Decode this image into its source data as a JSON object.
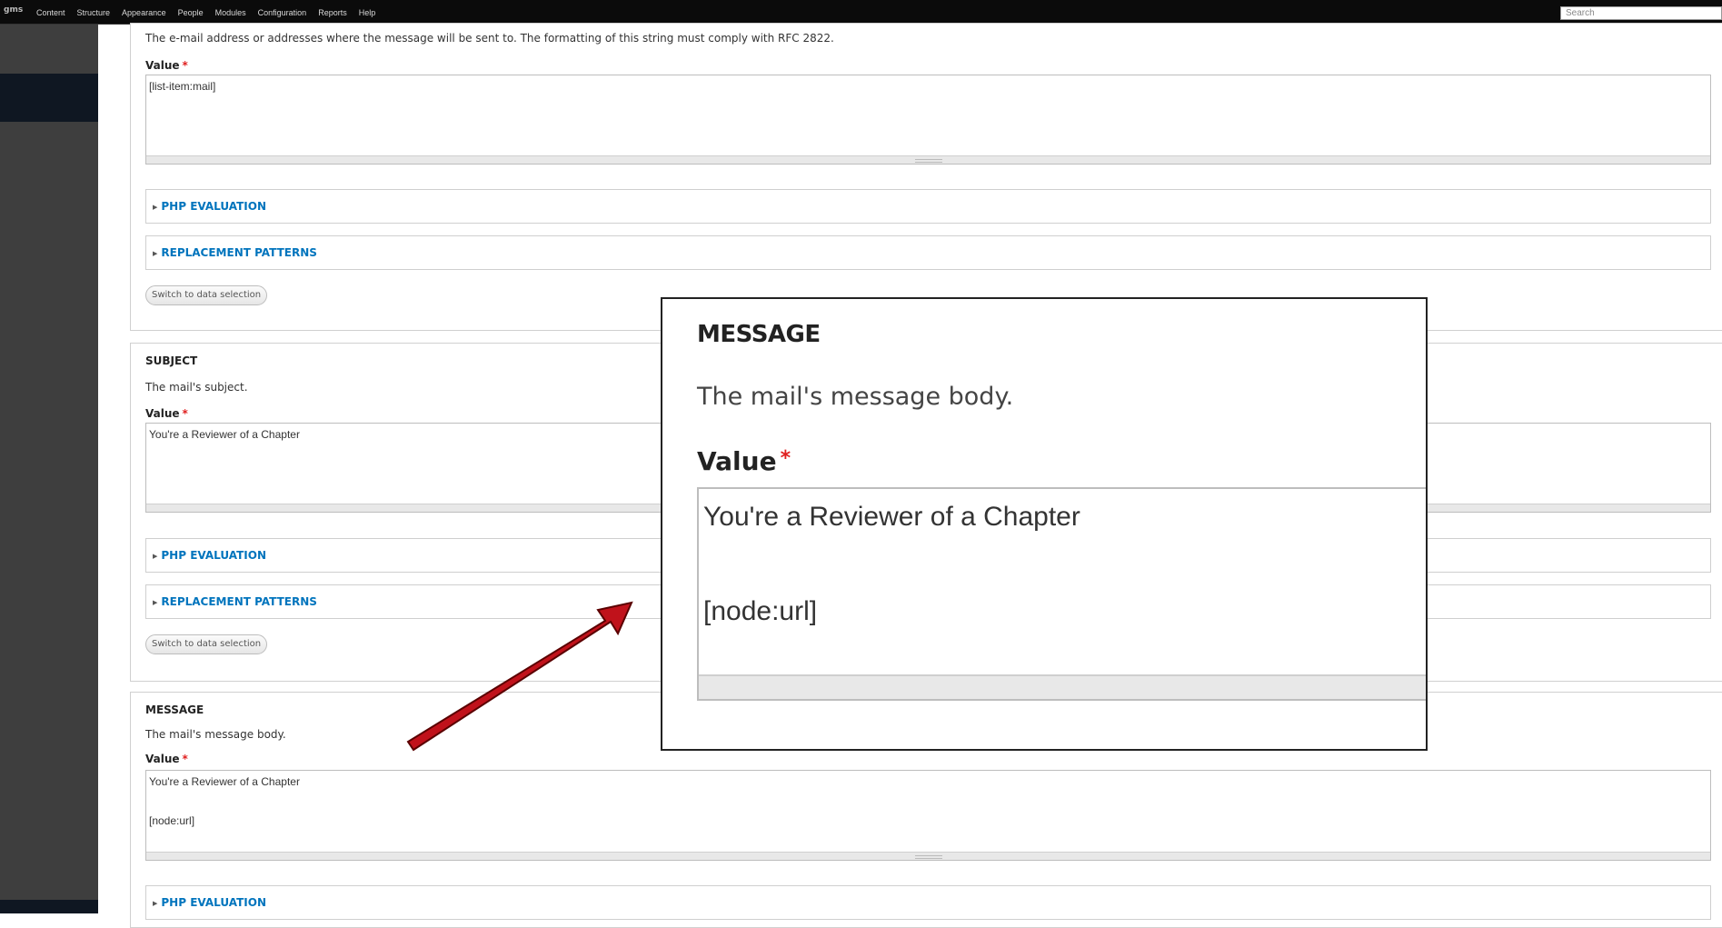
{
  "toolbar": {
    "brand": "gms",
    "menu": [
      "Content",
      "Structure",
      "Appearance",
      "People",
      "Modules",
      "Configuration",
      "Reports",
      "Help"
    ],
    "search_placeholder": "Search"
  },
  "to_section": {
    "description": "The e-mail address or addresses where the message will be sent to. The formatting of this string must comply with RFC 2822.",
    "value_label": "Value",
    "required_mark": "*",
    "value": "[list-item:mail]",
    "php_evaluation": "PHP EVALUATION",
    "replacement_patterns": "REPLACEMENT PATTERNS",
    "switch_button": "Switch to data selection"
  },
  "subject_section": {
    "title": "SUBJECT",
    "description": "The mail's subject.",
    "value_label": "Value",
    "required_mark": "*",
    "value": "You're a Reviewer of a Chapter",
    "php_evaluation": "PHP EVALUATION",
    "replacement_patterns": "REPLACEMENT PATTERNS",
    "switch_button": "Switch to data selection"
  },
  "message_section": {
    "title": "MESSAGE",
    "description": "The mail's message body.",
    "value_label": "Value",
    "required_mark": "*",
    "value_line1": "You're a Reviewer of a Chapter",
    "value_line2": "[node:url]",
    "php_evaluation": "PHP EVALUATION"
  },
  "callout": {
    "title": "MESSAGE",
    "description": "The mail's message body.",
    "value_label": "Value",
    "required_mark": "*",
    "value_line1": "You're a Reviewer of a Chapter",
    "value_line2": "[node:url]"
  },
  "colors": {
    "arrow": "#c0121b",
    "link": "#0074bd",
    "required": "#e02020"
  }
}
